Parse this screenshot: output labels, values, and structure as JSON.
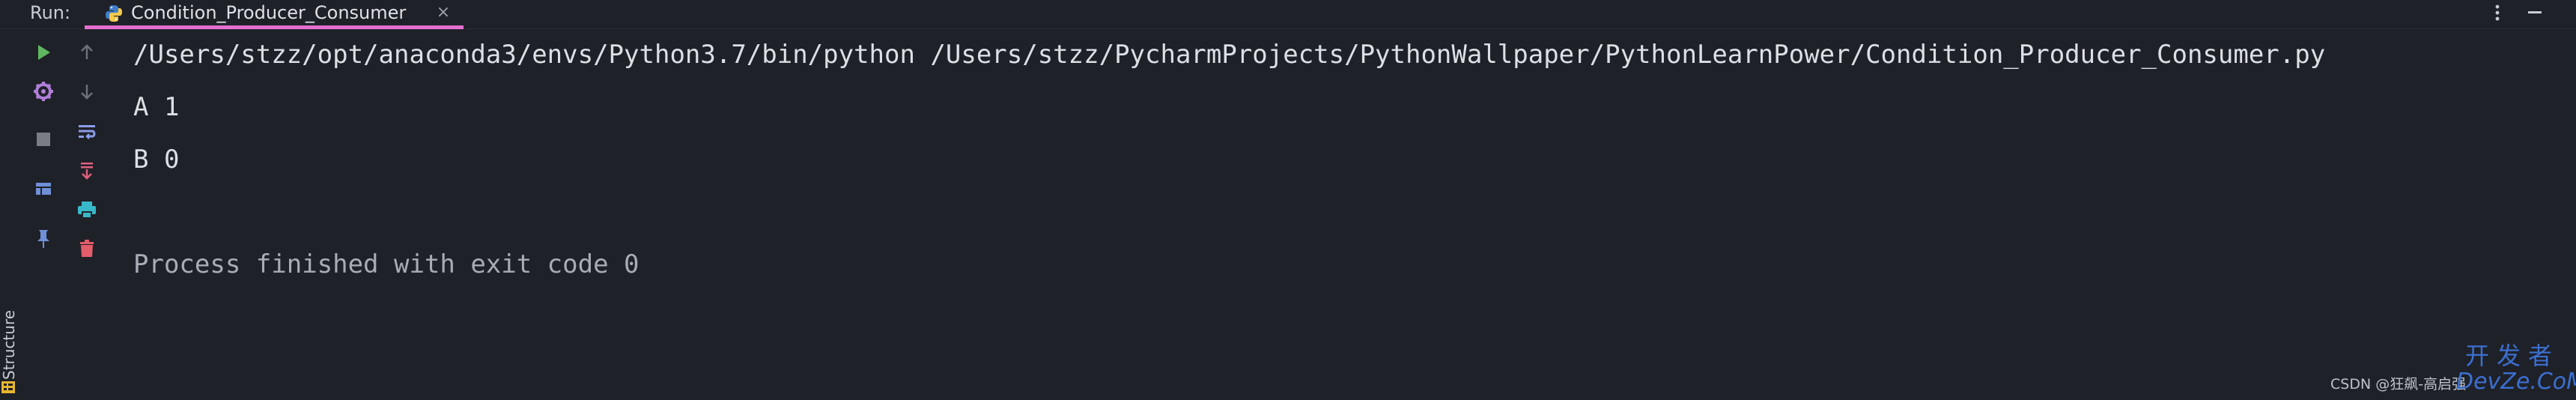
{
  "header": {
    "run_label": "Run:",
    "tab": {
      "title": "Condition_Producer_Consumer",
      "close": "×",
      "icon": "python-file-icon"
    },
    "kebab_icon": "more-vertical-icon",
    "minimize_icon": "minimize-icon"
  },
  "left_strip": {
    "structure_label": "Structure",
    "structure_icon": "structure-icon"
  },
  "toolbar": {
    "column1": [
      {
        "name": "rerun-icon",
        "color": "#5fb85f"
      },
      {
        "name": "settings-icon",
        "color": "#b07fd8"
      },
      {
        "name": "stop-icon",
        "color": "#7a7d85"
      },
      {
        "name": "layout-icon",
        "color": "#6f8fd6"
      },
      {
        "name": "pin-icon",
        "color": "#6f8fd6"
      }
    ],
    "column2": [
      {
        "name": "arrow-up-icon",
        "color": "#6d7078"
      },
      {
        "name": "arrow-down-icon",
        "color": "#6d7078"
      },
      {
        "name": "soft-wrap-icon",
        "color": "#8b9de8"
      },
      {
        "name": "scroll-to-end-icon",
        "color": "#e0607e"
      },
      {
        "name": "print-icon",
        "color": "#38b8c8"
      },
      {
        "name": "trash-icon",
        "color": "#e35d6a"
      }
    ]
  },
  "console": {
    "lines": [
      "/Users/stzz/opt/anaconda3/envs/Python3.7/bin/python /Users/stzz/PycharmProjects/PythonWallpaper/PythonLearnPower/Condition_Producer_Consumer.py",
      "A 1",
      "B 0",
      "",
      "Process finished with exit code 0"
    ]
  },
  "watermarks": {
    "csdn": "CSDN @狂飙-高启强",
    "devze_cn": "开发者",
    "devze_en": "DevZe.CoM"
  },
  "colors": {
    "background": "#1f2129",
    "tab_underline": "#e46fd0",
    "text": "#dcdfe4",
    "muted_text": "#a8acb4",
    "watermark_blue": "#3b6fd0"
  }
}
